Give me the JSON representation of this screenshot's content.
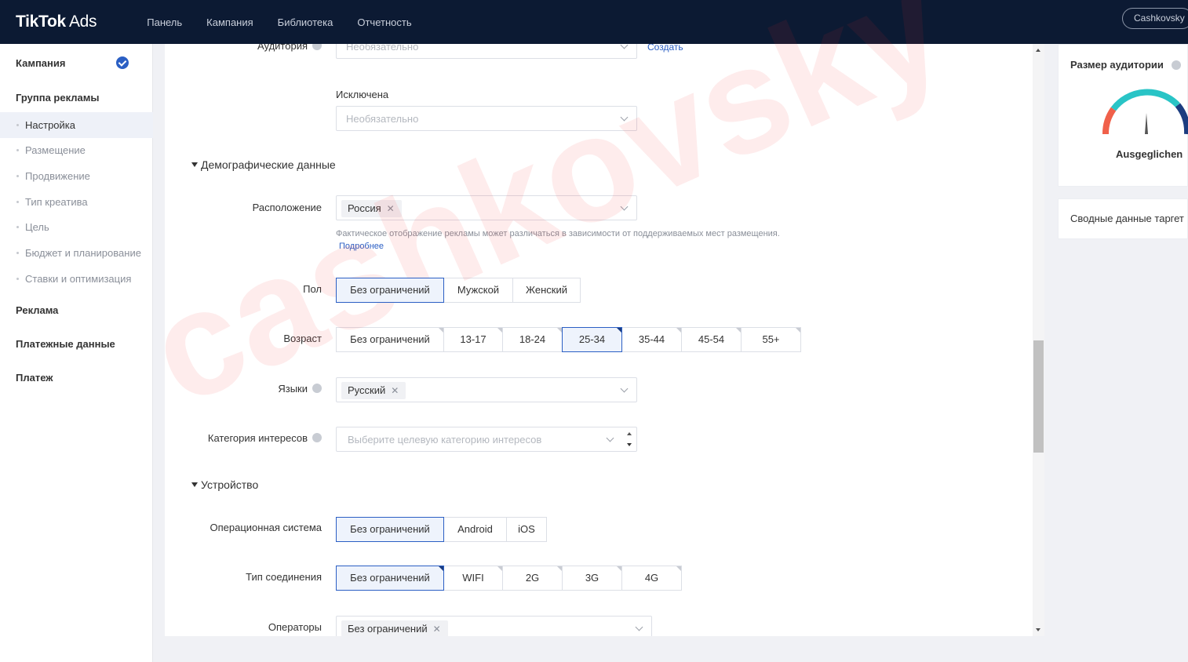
{
  "topbar": {
    "logo_main": "TikTok",
    "logo_sub": "Ads",
    "nav": [
      "Панель",
      "Кампания",
      "Библиотека",
      "Отчетность"
    ],
    "account": "Cashkovsky"
  },
  "sidebar": {
    "campaign": "Кампания",
    "adgroup": "Группа рекламы",
    "items": [
      "Настройка",
      "Размещение",
      "Продвижение",
      "Тип креатива",
      "Цель",
      "Бюджет и планирование",
      "Ставки и оптимизация"
    ],
    "ad": "Реклама",
    "payment_data": "Платежные данные",
    "payment": "Платеж"
  },
  "form": {
    "audience_label": "Аудитория",
    "audience_placeholder": "Необязательно",
    "create_link": "Создать",
    "excluded_label": "Исключена",
    "excluded_placeholder": "Необязательно",
    "demographics_section": "Демографические данные",
    "location_label": "Расположение",
    "location_tag": "Россия",
    "location_hint": "Фактическое отображение рекламы может различаться в зависимости от поддерживаемых мест размещения.",
    "location_more": "Подробнее",
    "gender_label": "Пол",
    "gender_options": [
      "Без ограничений",
      "Мужской",
      "Женский"
    ],
    "gender_selected": "Без ограничений",
    "age_label": "Возраст",
    "age_options": [
      "Без ограничений",
      "13-17",
      "18-24",
      "25-34",
      "35-44",
      "45-54",
      "55+"
    ],
    "age_selected": "25-34",
    "languages_label": "Языки",
    "language_tag": "Русский",
    "interests_label": "Категория интересов",
    "interests_placeholder": "Выберите целевую категорию интересов",
    "device_section": "Устройство",
    "os_label": "Операционная система",
    "os_options": [
      "Без ограничений",
      "Android",
      "iOS"
    ],
    "os_selected": "Без ограничений",
    "connection_label": "Тип соединения",
    "connection_options": [
      "Без ограничений",
      "WIFI",
      "2G",
      "3G",
      "4G"
    ],
    "connection_selected": "Без ограничений",
    "operators_label": "Операторы",
    "operators_tag": "Без ограничений"
  },
  "right_panel": {
    "audience_size_title": "Размер аудитории",
    "gauge_label": "Ausgeglichen",
    "summary_title": "Сводные данные таргет"
  },
  "watermark": "cashkovsky",
  "colors": {
    "topbar": "#0c1a33",
    "accent": "#2b5fc4",
    "selected_bg": "#eef3fc",
    "gauge_start": "#f0604a",
    "gauge_mid": "#29c4c6",
    "gauge_end": "#1b3c80"
  }
}
